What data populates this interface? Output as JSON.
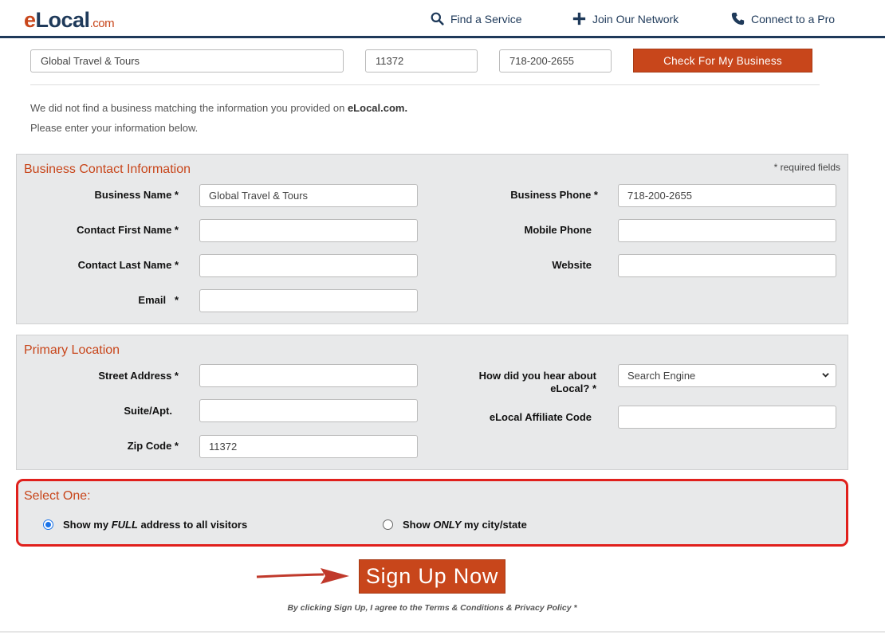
{
  "header": {
    "logo": {
      "e": "e",
      "rest": "Local",
      "com": ".com"
    },
    "nav": {
      "find": "Find a Service",
      "join": "Join Our Network",
      "connect": "Connect to a Pro"
    }
  },
  "lookup": {
    "business_name": "Global Travel & Tours",
    "zip": "11372",
    "phone": "718-200-2655",
    "check_button": "Check For My Business"
  },
  "message": {
    "line1_prefix": "We did not find a business matching the information you provided on ",
    "line1_brand": "eLocal.com.",
    "line2": "Please enter your information below."
  },
  "contact": {
    "title": "Business Contact Information",
    "required_note": "* required fields",
    "business_name_label": "Business Name *",
    "business_name_value": "Global Travel & Tours",
    "first_name_label": "Contact First Name *",
    "last_name_label": "Contact Last Name *",
    "email_label": "Email   *",
    "business_phone_label": "Business Phone *",
    "business_phone_value": "718-200-2655",
    "mobile_phone_label": "Mobile Phone",
    "website_label": "Website"
  },
  "location": {
    "title": "Primary Location",
    "street_label": "Street Address *",
    "suite_label": "Suite/Apt.",
    "zip_label": "Zip Code *",
    "zip_value": "11372",
    "hear_label_1": "How did you hear about",
    "hear_label_2": "eLocal? *",
    "hear_value": "Search Engine",
    "affiliate_label": "eLocal Affiliate Code"
  },
  "select_one": {
    "title": "Select One:",
    "option1_pre": "Show my ",
    "option1_em": "FULL",
    "option1_post": " address to all visitors",
    "option1_selected": true,
    "option2_pre": "Show ",
    "option2_em": "ONLY",
    "option2_post": " my city/state",
    "option2_selected": false
  },
  "signup": {
    "button": "Sign Up Now",
    "terms": "By clicking Sign Up, I agree to the Terms & Conditions & Privacy Policy *"
  },
  "colors": {
    "brand_orange": "#c8461b",
    "brand_navy": "#1f3a5a",
    "highlight_red": "#e0201c"
  }
}
